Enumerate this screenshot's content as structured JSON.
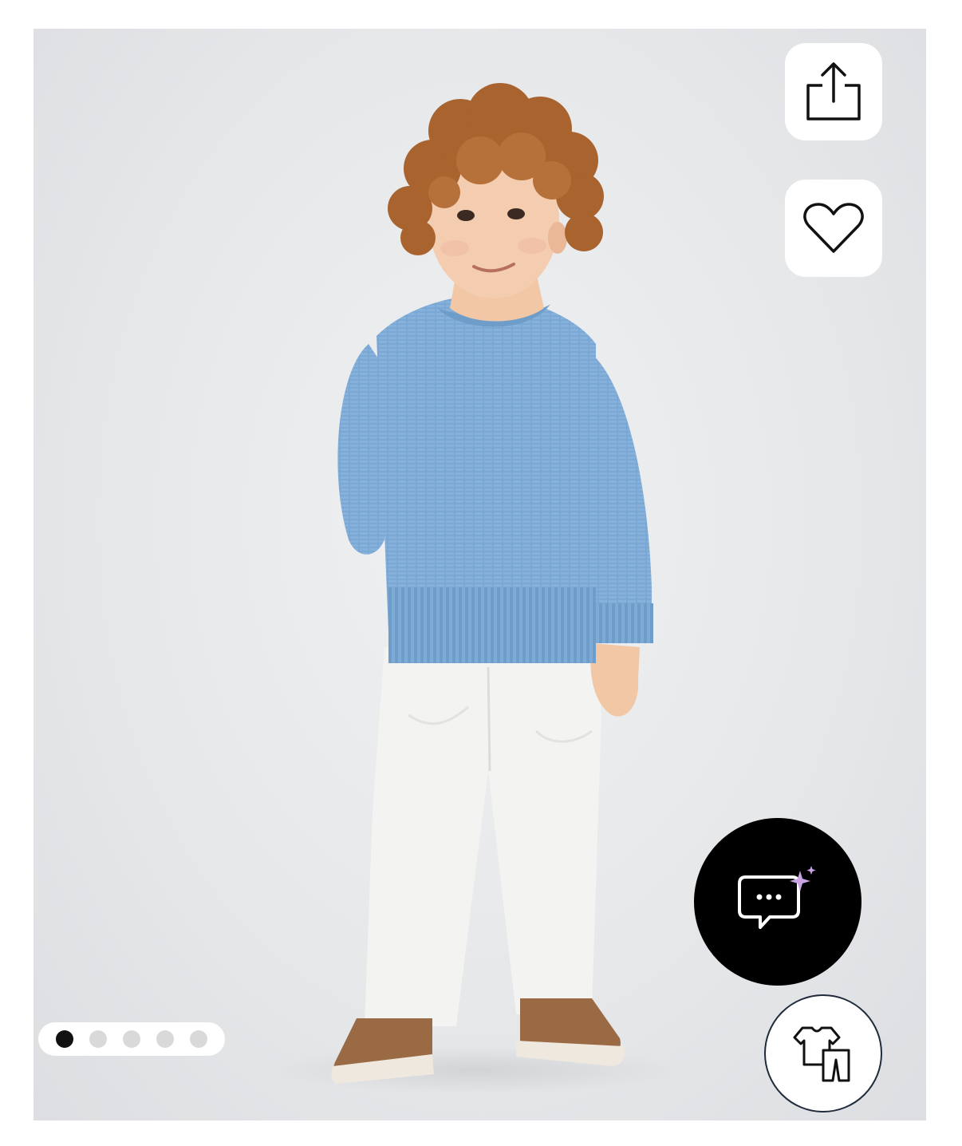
{
  "gallery": {
    "image_alt": "",
    "active_index": 0,
    "total_images": 5
  },
  "actions": {
    "share_icon": "share-icon",
    "favorite_icon": "heart-icon"
  },
  "assistant": {
    "icon": "chat-sparkle-icon"
  },
  "outfit": {
    "icon": "outfit-icon"
  },
  "colors": {
    "sweater": "#7aa7d4",
    "pants": "#f3f3f1",
    "shoes": "#9a6a45",
    "fab_background": "#000000",
    "sparkle": "#c9a3e6"
  }
}
